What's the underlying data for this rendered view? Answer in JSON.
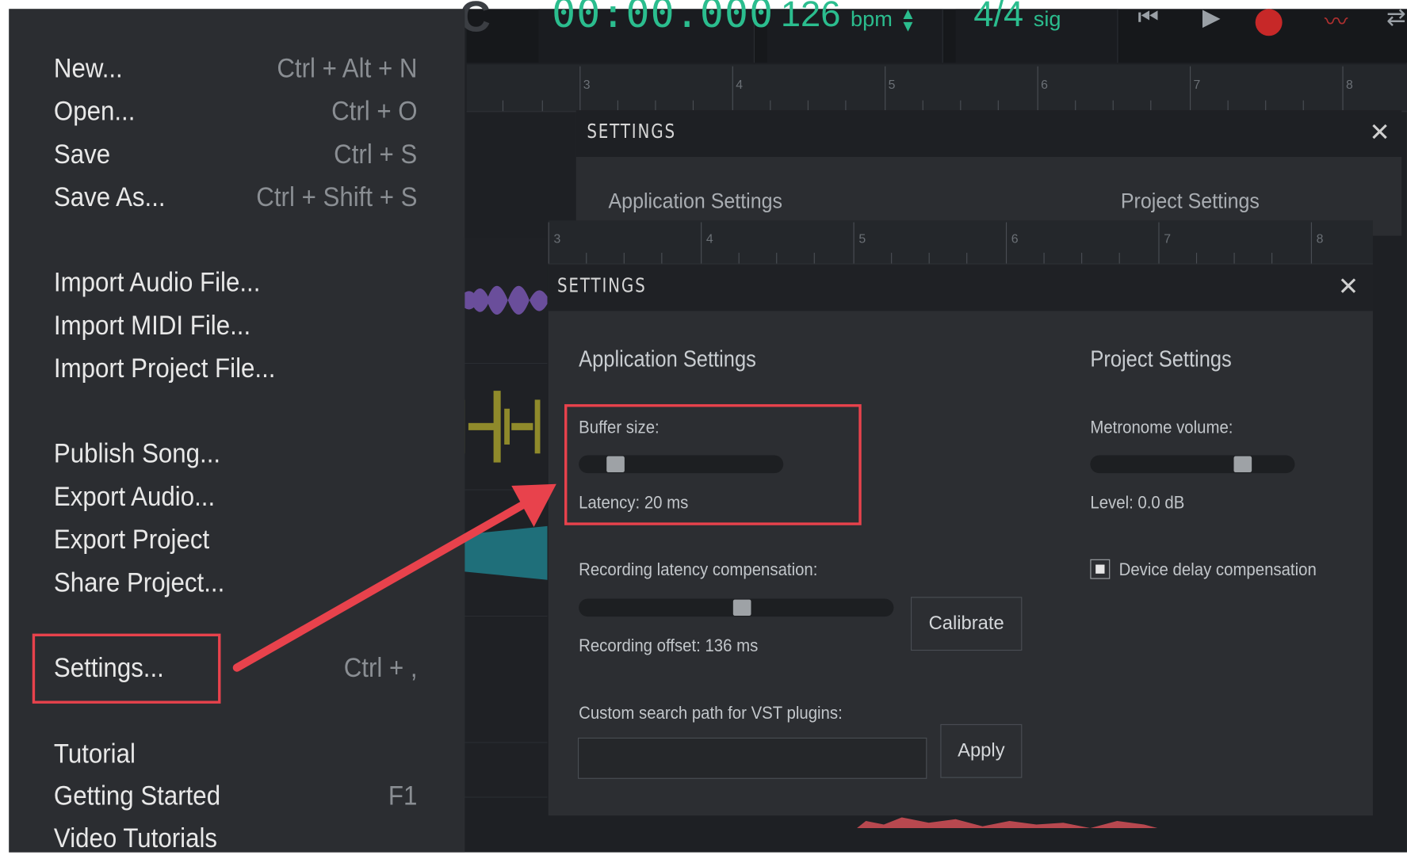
{
  "transport": {
    "time": "00:00.000",
    "bpm_value": "126",
    "bpm_unit": "bpm",
    "sig_value": "4/4",
    "sig_unit": "sig",
    "logo_char": "C",
    "icons": [
      "skip-back-icon",
      "play-icon",
      "record-icon",
      "automation-icon",
      "loop-icon"
    ]
  },
  "ruler_top": {
    "numbers": [
      "3",
      "4",
      "5",
      "6",
      "7",
      "8"
    ]
  },
  "ruler_mid": {
    "numbers": [
      "3",
      "4",
      "5",
      "6",
      "7",
      "8"
    ]
  },
  "file_menu": {
    "items": [
      {
        "label": "New...",
        "shortcut": "Ctrl + Alt + N"
      },
      {
        "label": "Open...",
        "shortcut": "Ctrl + O"
      },
      {
        "label": "Save",
        "shortcut": "Ctrl + S"
      },
      {
        "label": "Save As...",
        "shortcut": "Ctrl + Shift + S"
      },
      {
        "label": "Import Audio File...",
        "shortcut": ""
      },
      {
        "label": "Import MIDI File...",
        "shortcut": ""
      },
      {
        "label": "Import Project File...",
        "shortcut": ""
      },
      {
        "label": "Publish Song...",
        "shortcut": ""
      },
      {
        "label": "Export Audio...",
        "shortcut": ""
      },
      {
        "label": "Export Project",
        "shortcut": ""
      },
      {
        "label": "Share Project...",
        "shortcut": ""
      },
      {
        "label": "Settings...",
        "shortcut": "Ctrl + ,"
      },
      {
        "label": "Tutorial",
        "shortcut": ""
      },
      {
        "label": "Getting Started",
        "shortcut": "F1"
      },
      {
        "label": "Video Tutorials",
        "shortcut": ""
      }
    ]
  },
  "settings_back": {
    "title": "SETTINGS",
    "app_section": "Application Settings",
    "project_section": "Project Settings"
  },
  "settings": {
    "title": "SETTINGS",
    "app_section": "Application Settings",
    "project_section": "Project Settings",
    "buffer_label": "Buffer size:",
    "buffer_value": 0.15,
    "latency_text": "Latency: 20 ms",
    "rec_comp_label": "Recording latency compensation:",
    "rec_comp_value": 0.52,
    "rec_offset_text": "Recording offset: 136 ms",
    "calibrate_label": "Calibrate",
    "vst_label": "Custom search path for VST plugins:",
    "vst_value": "",
    "apply_label": "Apply",
    "metronome_label": "Metronome volume:",
    "metronome_value": 0.77,
    "level_text": "Level: 0.0 dB",
    "device_delay_label": "Device delay compensation",
    "device_delay_checked": true
  },
  "colors": {
    "accent_green": "#2bbd8e",
    "highlight_red": "#e8424c",
    "record_red": "#c72828"
  }
}
